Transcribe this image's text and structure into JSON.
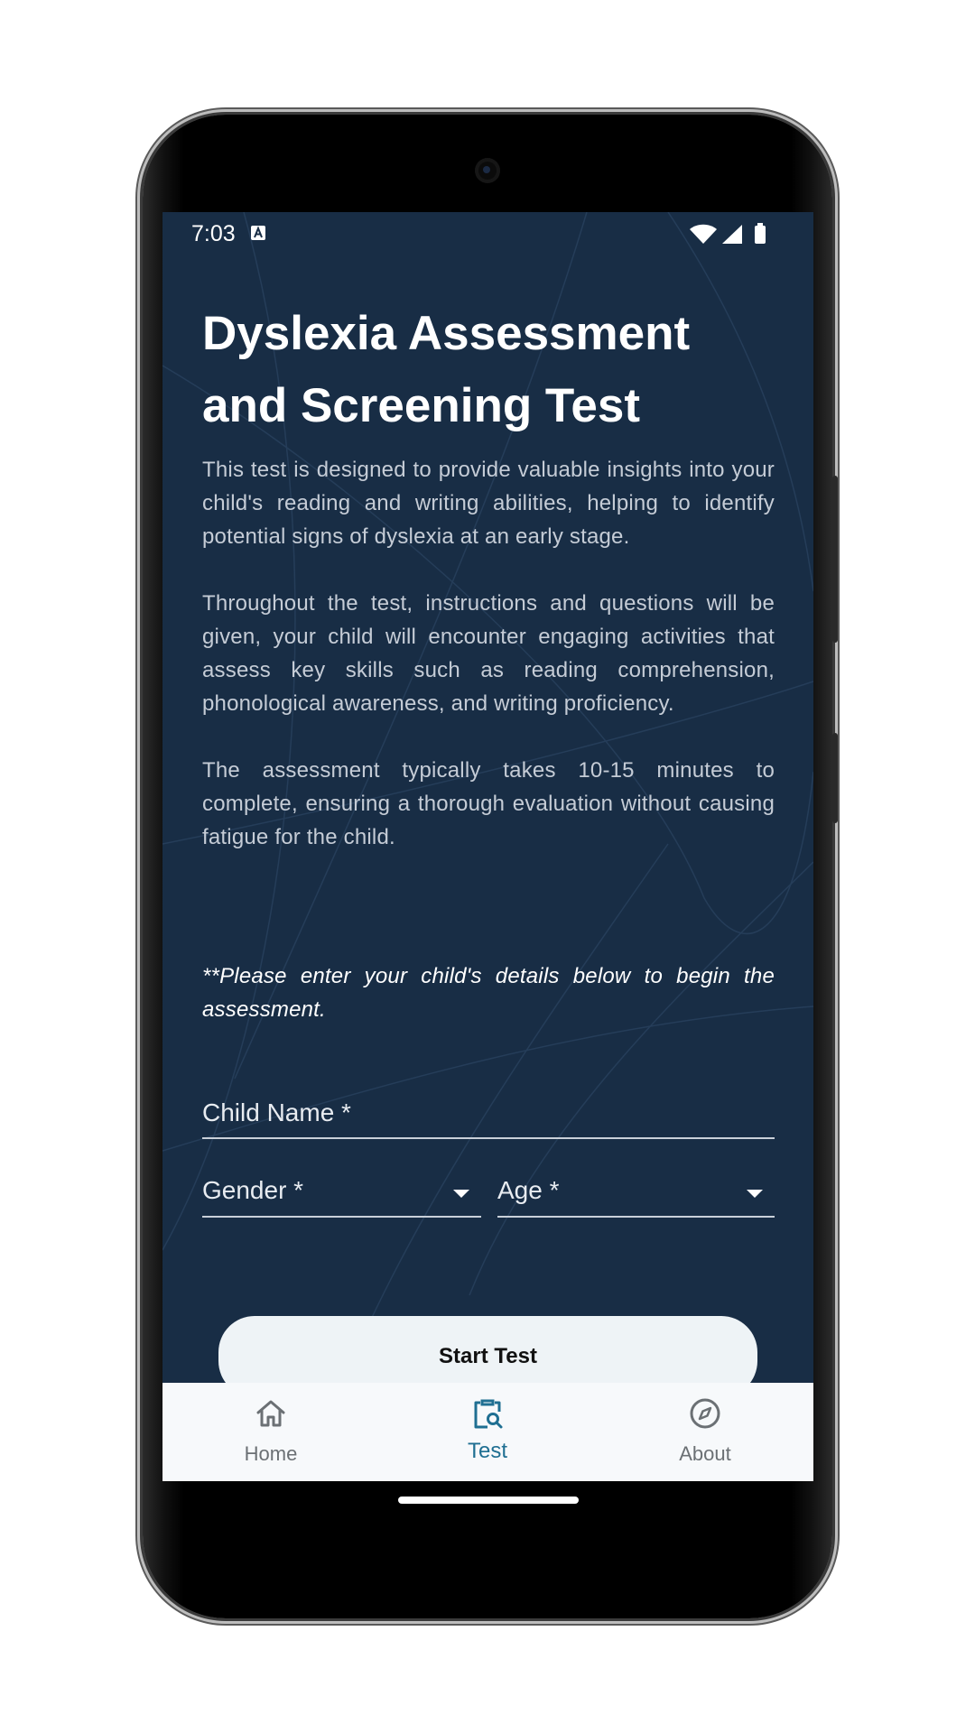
{
  "status_bar": {
    "time": "7:03"
  },
  "page": {
    "title_line1": "Dyslexia Assessment",
    "title_line2": "and Screening Test",
    "para1": "This test is designed to provide valuable insights into your child's reading and writing abilities, helping to identify potential signs of dyslexia at an early stage.",
    "para2": "Throughout the test, instructions and questions will be given, your child will encounter engaging activities that assess key skills such as reading comprehension, phonological awareness, and writing proficiency.",
    "para3": "The assessment typically takes 10-15 minutes to complete, ensuring a thorough evaluation without causing fatigue for the child.",
    "note": "**Please enter your child's details below to begin the assessment."
  },
  "form": {
    "child_name_label": "Child Name *",
    "gender_label": "Gender *",
    "age_label": "Age *",
    "start_button": "Start Test"
  },
  "nav": {
    "items": [
      {
        "label": "Home",
        "icon": "home-icon",
        "active": false
      },
      {
        "label": "Test",
        "icon": "clipboard-search-icon",
        "active": true
      },
      {
        "label": "About",
        "icon": "compass-icon",
        "active": false
      }
    ]
  },
  "colors": {
    "background": "#182d45",
    "accent": "#1f6f92",
    "nav_background": "#f7f9fb",
    "button_background": "#eef3f6"
  }
}
